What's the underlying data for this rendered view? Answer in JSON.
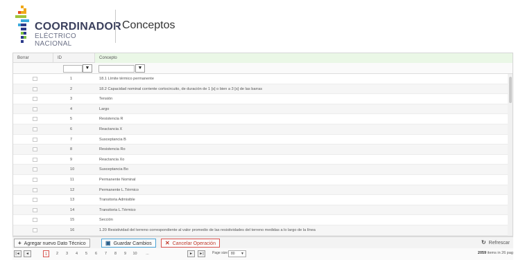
{
  "header": {
    "logo_line1": "COORDINADOR",
    "logo_line2": "ELÉCTRICO NACIONAL",
    "page_title": "Conceptos",
    "logo_colors": [
      "#f0a818",
      "#e94f1d",
      "#9fc43a",
      "#3aa9dc",
      "#2b3a8a",
      "#7ac143"
    ]
  },
  "grid": {
    "columns": [
      "Borrar",
      "ID",
      "Concepto"
    ],
    "rows": [
      {
        "id": "1",
        "concepto": "18.1 Límite térmico permanente"
      },
      {
        "id": "2",
        "concepto": "18.2 Capacidad nominal corriente cortocircuito, de duración de 1 [s] o bien a 3 [s] de las barras"
      },
      {
        "id": "3",
        "concepto": "Tensión"
      },
      {
        "id": "4",
        "concepto": "Largo"
      },
      {
        "id": "5",
        "concepto": "Resistencia R"
      },
      {
        "id": "6",
        "concepto": "Reactancia X"
      },
      {
        "id": "7",
        "concepto": "Susceptancia B"
      },
      {
        "id": "8",
        "concepto": "Resistencia Ro"
      },
      {
        "id": "9",
        "concepto": "Reactancia Xo"
      },
      {
        "id": "10",
        "concepto": "Susceptancia Bo"
      },
      {
        "id": "11",
        "concepto": "Permanente Nominal"
      },
      {
        "id": "12",
        "concepto": "Permanente L.Térmico"
      },
      {
        "id": "13",
        "concepto": "Transitoria Admisible"
      },
      {
        "id": "14",
        "concepto": "Transitoria L.Térmico"
      },
      {
        "id": "15",
        "concepto": "Sección"
      },
      {
        "id": "16",
        "concepto": "1.20 Resistividad del terreno correspondiente al valor promedio de las resistividades del terreno medidas a lo largo de la línea"
      }
    ]
  },
  "toolbar": {
    "add_label": "Agregar nuevo Dato Técnico",
    "save_label": "Guardar Cambios",
    "cancel_label": "Cancelar Operación",
    "refresh_label": "Refrescar"
  },
  "pager": {
    "first": "|◄",
    "prev": "◄",
    "pages": [
      "1",
      "2",
      "3",
      "4",
      "5",
      "6",
      "7",
      "8",
      "9",
      "10",
      "..."
    ],
    "current_page": "1",
    "next": "►",
    "last": "►|",
    "page_size_label": "Page size:",
    "page_size": "80",
    "items_count": "2059",
    "items_suffix": "items in 26 pag"
  }
}
